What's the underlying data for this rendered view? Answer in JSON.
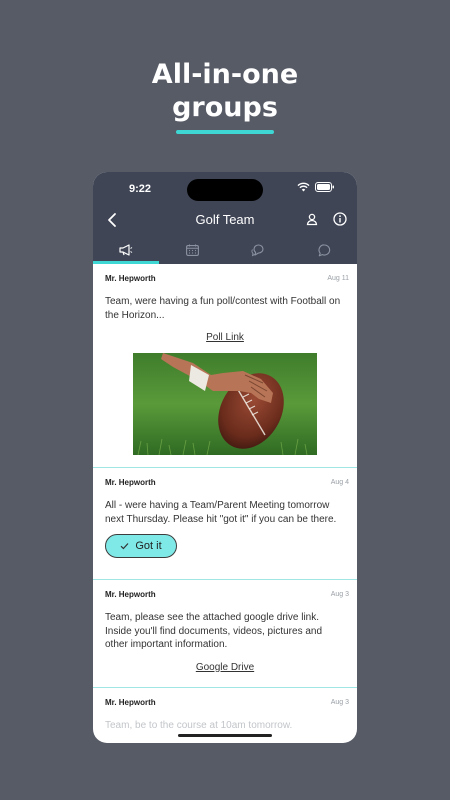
{
  "promo": {
    "line1": "All-in-one",
    "line2": "groups"
  },
  "status_bar": {
    "time": "9:22"
  },
  "nav": {
    "title": "Golf Team"
  },
  "tabs": [
    {
      "icon": "megaphone-icon",
      "active": true
    },
    {
      "icon": "calendar-icon",
      "active": false
    },
    {
      "icon": "chat-bubbles-icon",
      "active": false
    },
    {
      "icon": "chat-bubble-icon",
      "active": false
    }
  ],
  "posts": [
    {
      "author": "Mr. Hepworth",
      "date": "Aug 11",
      "text": "Team, were having a fun poll/contest with Football on the Horizon...",
      "link": "Poll Link"
    },
    {
      "author": "Mr. Hepworth",
      "date": "Aug 4",
      "text": "All - were having a Team/Parent Meeting tomorrow next Thursday.  Please hit \"got it\" if you can be there.",
      "button": "Got it"
    },
    {
      "author": "Mr. Hepworth",
      "date": "Aug 3",
      "text": "Team, please see the attached google drive link. Inside you'll find documents, videos, pictures and other important information.",
      "link": "Google Drive"
    },
    {
      "author": "Mr. Hepworth",
      "date": "Aug 3",
      "text": "Team, be to the course at 10am tomorrow."
    }
  ],
  "colors": {
    "background": "#575b66",
    "accent": "#3fd7d4",
    "header": "#3f4555",
    "button_fill": "#7fe9e7"
  }
}
